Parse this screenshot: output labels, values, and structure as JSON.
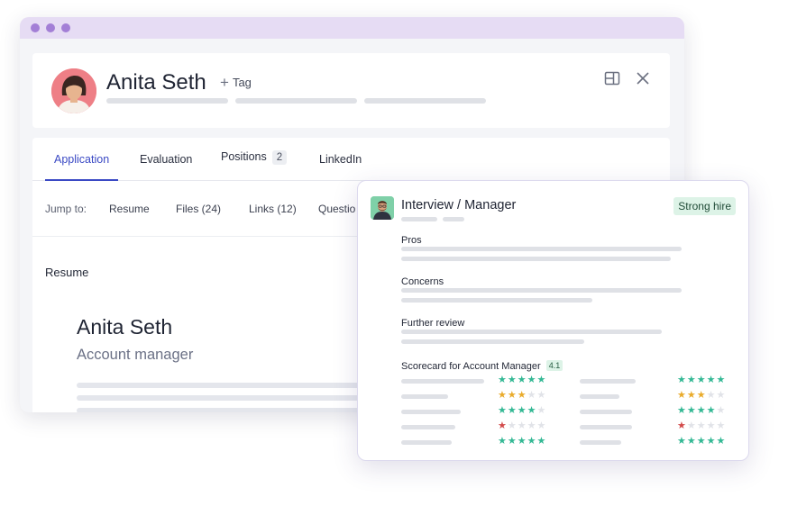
{
  "candidate": {
    "name": "Anita Seth",
    "tag_label": "Tag"
  },
  "tabs": [
    {
      "label": "Application",
      "active": true
    },
    {
      "label": "Evaluation",
      "active": false
    },
    {
      "label": "Positions",
      "count": "2",
      "active": false
    },
    {
      "label": "LinkedIn",
      "active": false
    }
  ],
  "jump": {
    "label": "Jump to:",
    "items": [
      "Resume",
      "Files (24)",
      "Links (12)",
      "Questio"
    ]
  },
  "resume": {
    "section_label": "Resume",
    "name": "Anita Seth",
    "title": "Account manager"
  },
  "interview": {
    "title": "Interview / Manager",
    "verdict": "Strong hire",
    "sections": [
      "Pros",
      "Concerns",
      "Further review"
    ],
    "scorecard_label": "Scorecard for Account Manager",
    "score": "4.1",
    "ratings_left": [
      5,
      3,
      4,
      1,
      5
    ],
    "ratings_right": [
      5,
      3,
      4,
      1,
      5
    ]
  },
  "icons": {
    "tag": "plus-icon",
    "layout": "panel-layout-icon",
    "close": "close-icon",
    "star": "star-icon"
  },
  "colors": {
    "accent": "#3a49c4",
    "titlebar": "#e6dcf4",
    "star_high": "#33b894",
    "star_mid": "#e9ab2b",
    "star_low": "#d24a4a",
    "badge_bg": "#ddf3e7"
  }
}
